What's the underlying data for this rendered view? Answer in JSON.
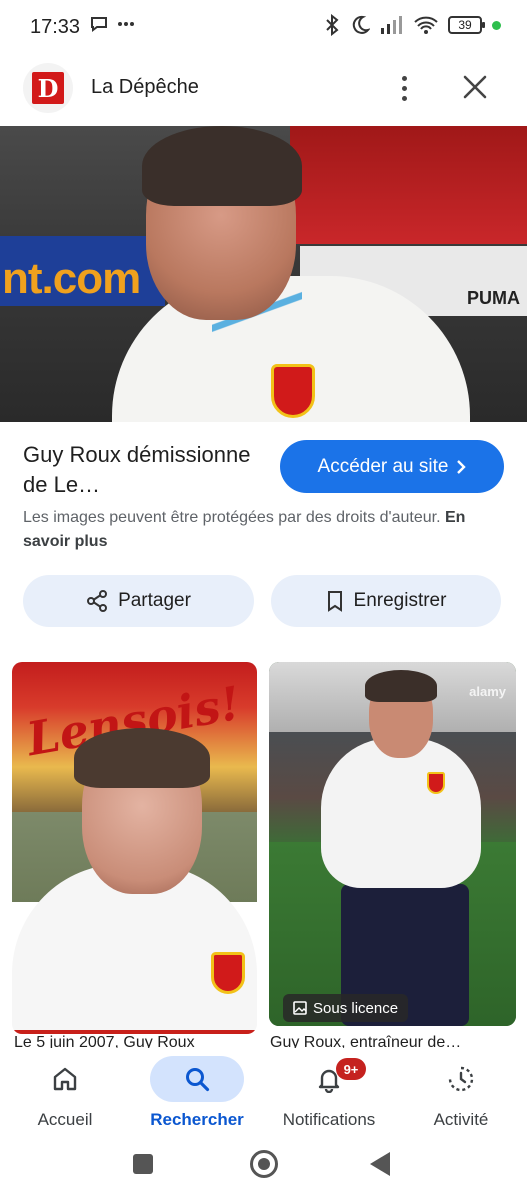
{
  "status_bar": {
    "time": "17:33",
    "left_icons": [
      "chat-bubble-icon",
      "more-horizontal-icon"
    ],
    "right_icons": [
      "bluetooth-icon",
      "moon-icon",
      "signal-icon",
      "wifi-icon"
    ],
    "battery": "39"
  },
  "header": {
    "site_name": "La Dépêche",
    "logo_letter": "D",
    "brand_color": "#d21a1a"
  },
  "hero": {
    "sign_left": "nt.com",
    "sign_right": "PUMA",
    "crest": "RCL"
  },
  "result": {
    "title": "Guy Roux démissionne de Le…",
    "visit_button": "Accéder au site",
    "copyright_text": "Les images peuvent être protégées par des droits d'auteur. ",
    "learn_more": "En savoir plus",
    "accent_color": "#1b73e8"
  },
  "actions": {
    "share": "Partager",
    "save": "Enregistrer"
  },
  "related": [
    {
      "sign_text": "Lensois!",
      "caption": "Le 5 juin 2007, Guy Roux"
    },
    {
      "watermark": "alamy",
      "badge": "Sous licence",
      "caption": "Guy Roux, entraîneur de…"
    }
  ],
  "bottom_nav": {
    "items": [
      {
        "label": "Accueil",
        "icon": "home-icon"
      },
      {
        "label": "Rechercher",
        "icon": "search-icon",
        "active": true
      },
      {
        "label": "Notifications",
        "icon": "bell-icon",
        "badge": "9+"
      },
      {
        "label": "Activité",
        "icon": "activity-icon"
      }
    ]
  }
}
